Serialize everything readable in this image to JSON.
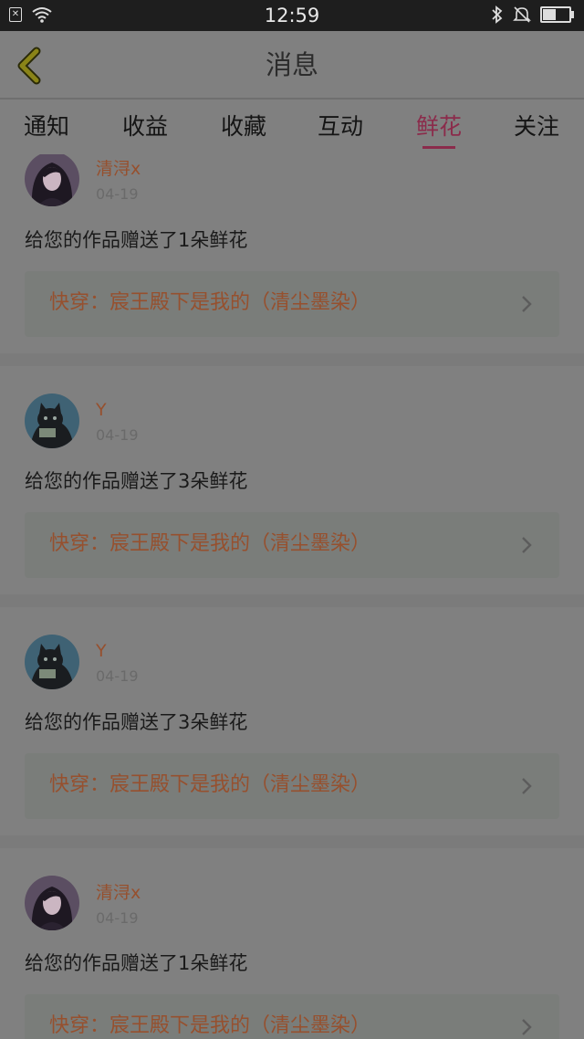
{
  "status_bar": {
    "time": "12:59",
    "icons": [
      "sim-icon",
      "wifi-icon",
      "bluetooth-icon",
      "mute-icon",
      "battery-icon"
    ],
    "battery_level": 0.5
  },
  "header": {
    "title": "消息"
  },
  "tabs": [
    {
      "label": "通知",
      "active": false
    },
    {
      "label": "收益",
      "active": false
    },
    {
      "label": "收藏",
      "active": false
    },
    {
      "label": "互动",
      "active": false
    },
    {
      "label": "鲜花",
      "active": true
    },
    {
      "label": "关注",
      "active": false
    }
  ],
  "feed": [
    {
      "username": "清浔x",
      "date": "04-19",
      "message": "给您的作品赠送了1朵鲜花",
      "work_title": "快穿：宸王殿下是我的（清尘墨染）",
      "avatar": "girl-avatar"
    },
    {
      "username": "Y",
      "date": "04-19",
      "message": "给您的作品赠送了3朵鲜花",
      "work_title": "快穿：宸王殿下是我的（清尘墨染）",
      "avatar": "cat-avatar"
    },
    {
      "username": "Y",
      "date": "04-19",
      "message": "给您的作品赠送了3朵鲜花",
      "work_title": "快穿：宸王殿下是我的（清尘墨染）",
      "avatar": "cat-avatar"
    },
    {
      "username": "清浔x",
      "date": "04-19",
      "message": "给您的作品赠送了1朵鲜花",
      "work_title": "快穿：宸王殿下是我的（清尘墨染）",
      "avatar": "girl-avatar"
    }
  ],
  "colors": {
    "overlay_bg": "#808080",
    "accent_tab": "#8b2b4b",
    "username": "#96502e",
    "work_title": "#96502e"
  }
}
